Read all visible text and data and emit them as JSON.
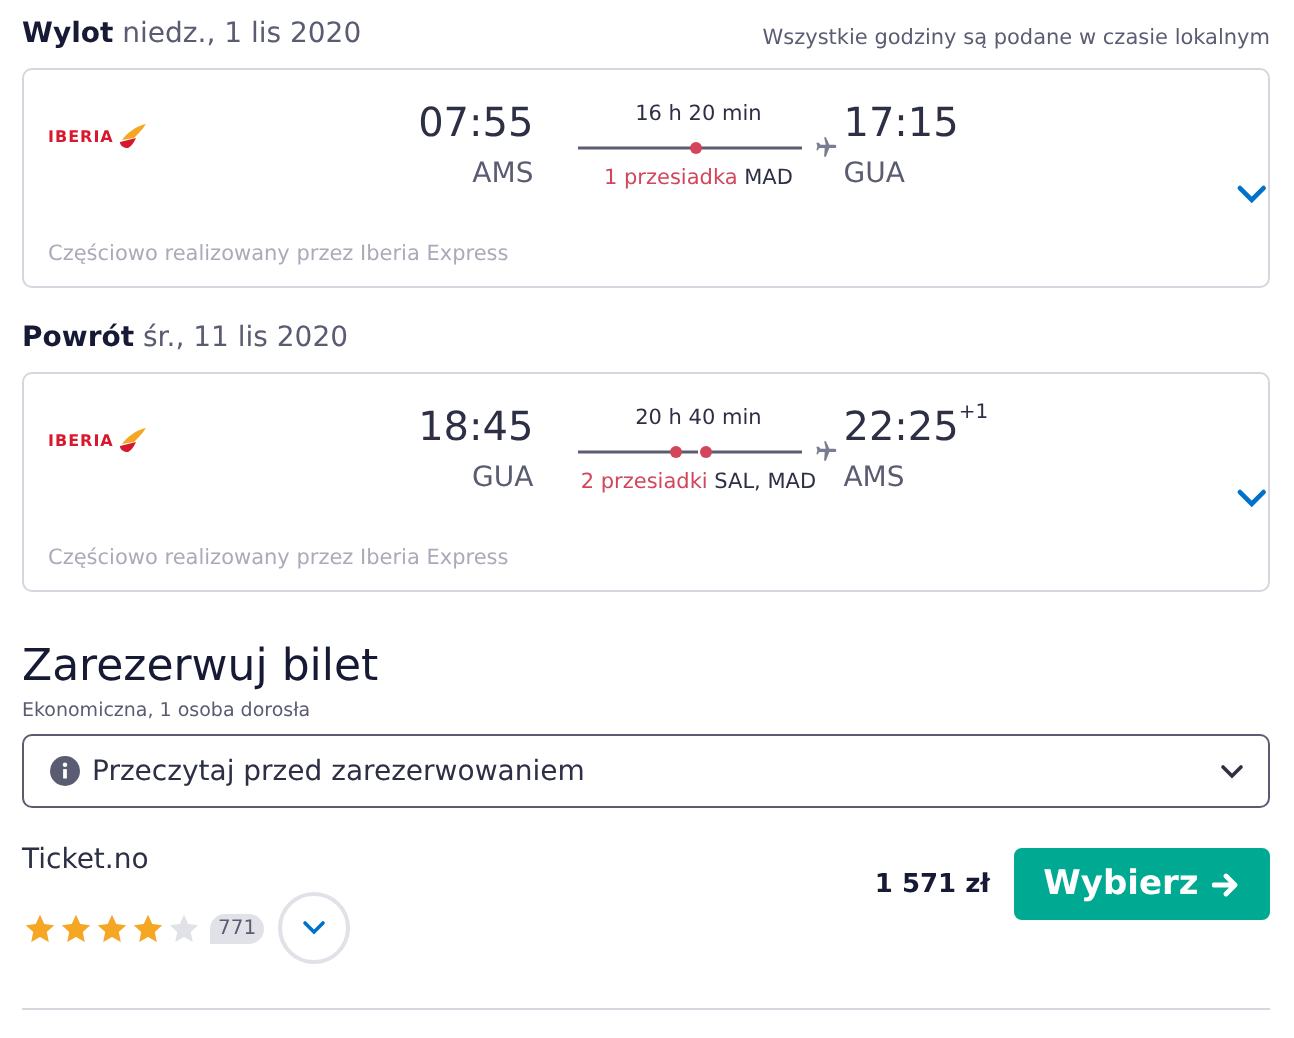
{
  "legs": [
    {
      "label": "Wylot",
      "date": "niedz., 1 lis 2020",
      "note": "Wszystkie godziny są podane w czasie lokalnym",
      "airline": "IBERIA",
      "dep_time": "07:55",
      "dep_airport": "AMS",
      "duration": "16 h 20 min",
      "stops_label": "1 przesiadka",
      "via": "MAD",
      "arr_time": "17:15",
      "arr_airport": "GUA",
      "operator": "Częściowo realizowany przez Iberia Express"
    },
    {
      "label": "Powrót",
      "date": "śr., 11 lis 2020",
      "airline": "IBERIA",
      "dep_time": "18:45",
      "dep_airport": "GUA",
      "duration": "20 h 40 min",
      "stops_label": "2 przesiadki",
      "via": "SAL, MAD",
      "arr_time": "22:25",
      "day_offset": "+1",
      "arr_airport": "AMS",
      "operator": "Częściowo realizowany przez Iberia Express"
    }
  ],
  "booking": {
    "title": "Zarezerwuj bilet",
    "subtitle": "Ekonomiczna, 1 osoba dorosła",
    "notice": "Przeczytaj przed zarezerwowaniem",
    "provider": "Ticket.no",
    "stars": 4,
    "reviews": "771",
    "price": "1 571 zł",
    "button": "Wybierz"
  }
}
